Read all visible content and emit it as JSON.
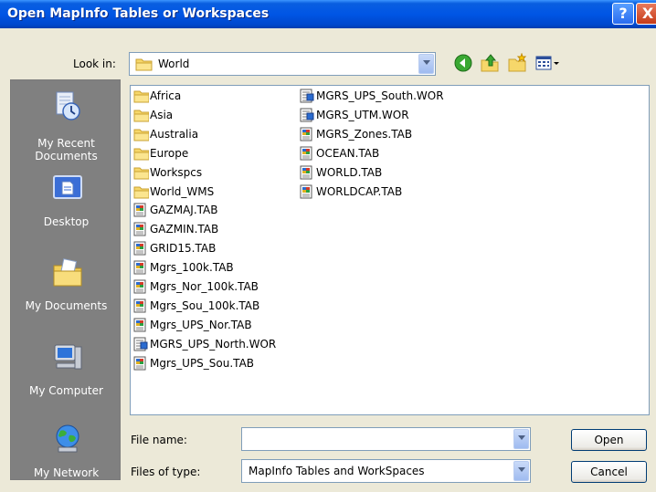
{
  "dialog": {
    "title": "Open MapInfo Tables or Workspaces"
  },
  "titlebar": {
    "help_glyph": "?",
    "close_glyph": "X"
  },
  "lookin": {
    "label": "Look in:",
    "value": "World"
  },
  "toolbar_icons": [
    "back-icon",
    "up-folder-icon",
    "new-folder-icon",
    "views-menu-icon"
  ],
  "places": [
    {
      "label": "My Recent Documents",
      "icon": "recent-documents-icon"
    },
    {
      "label": "Desktop",
      "icon": "desktop-icon"
    },
    {
      "label": "My Documents",
      "icon": "my-documents-icon"
    },
    {
      "label": "My Computer",
      "icon": "my-computer-icon"
    },
    {
      "label": "My Network",
      "icon": "my-network-icon"
    }
  ],
  "files_col1": [
    {
      "name": "Africa",
      "type": "folder"
    },
    {
      "name": "Asia",
      "type": "folder"
    },
    {
      "name": "Australia",
      "type": "folder"
    },
    {
      "name": "Europe",
      "type": "folder"
    },
    {
      "name": "Workspcs",
      "type": "folder"
    },
    {
      "name": "World_WMS",
      "type": "folder"
    },
    {
      "name": "GAZMAJ.TAB",
      "type": "tab"
    },
    {
      "name": "GAZMIN.TAB",
      "type": "tab"
    },
    {
      "name": "GRID15.TAB",
      "type": "tab"
    },
    {
      "name": "Mgrs_100k.TAB",
      "type": "tab"
    },
    {
      "name": "Mgrs_Nor_100k.TAB",
      "type": "tab"
    },
    {
      "name": "Mgrs_Sou_100k.TAB",
      "type": "tab"
    },
    {
      "name": "Mgrs_UPS_Nor.TAB",
      "type": "tab"
    },
    {
      "name": "MGRS_UPS_North.WOR",
      "type": "wor"
    },
    {
      "name": "Mgrs_UPS_Sou.TAB",
      "type": "tab"
    }
  ],
  "files_col2": [
    {
      "name": "MGRS_UPS_South.WOR",
      "type": "wor"
    },
    {
      "name": "MGRS_UTM.WOR",
      "type": "wor"
    },
    {
      "name": "MGRS_Zones.TAB",
      "type": "tab"
    },
    {
      "name": "OCEAN.TAB",
      "type": "tab"
    },
    {
      "name": "WORLD.TAB",
      "type": "tab"
    },
    {
      "name": "WORLDCAP.TAB",
      "type": "tab"
    }
  ],
  "filename": {
    "label": "File name:",
    "value": ""
  },
  "filetype": {
    "label": "Files of type:",
    "value": "MapInfo Tables and WorkSpaces"
  },
  "buttons": {
    "open": "Open",
    "cancel": "Cancel"
  }
}
